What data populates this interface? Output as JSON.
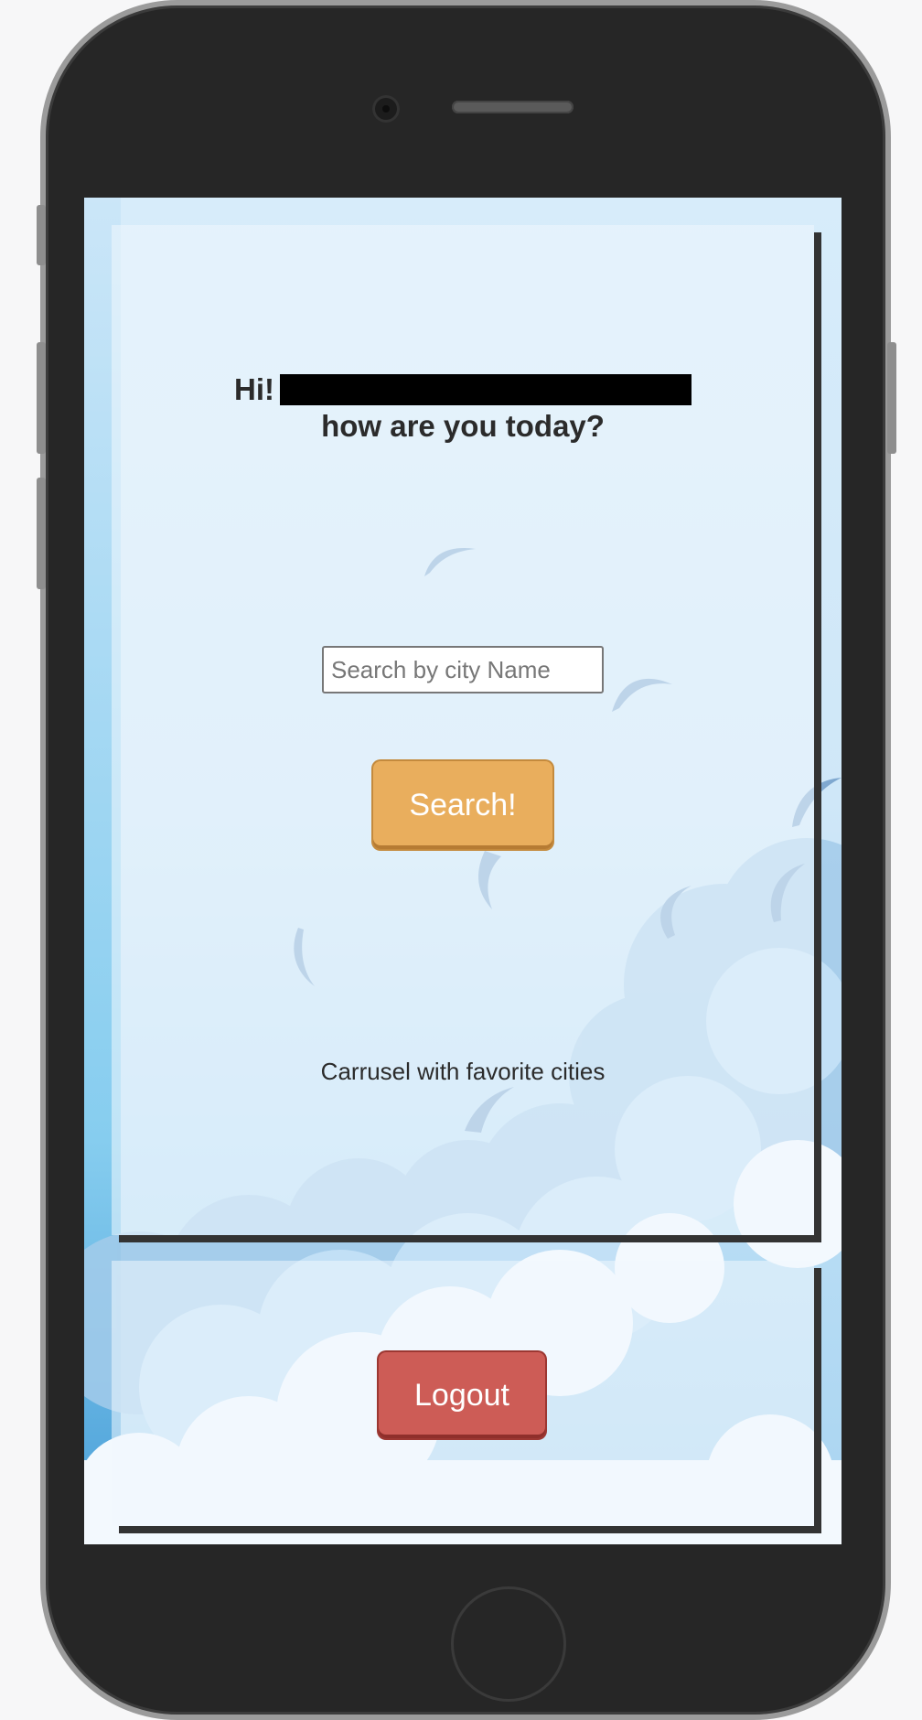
{
  "greeting": {
    "hi": "Hi!",
    "question": "how are you today?"
  },
  "search": {
    "placeholder": "Search by city Name",
    "button_label": "Search!"
  },
  "carousel": {
    "label": "Carrusel with favorite cities"
  },
  "logout": {
    "button_label": "Logout"
  },
  "colors": {
    "search_button": "#e9ae5d",
    "logout_button": "#cd5c56",
    "card_shadow": "#333333"
  }
}
